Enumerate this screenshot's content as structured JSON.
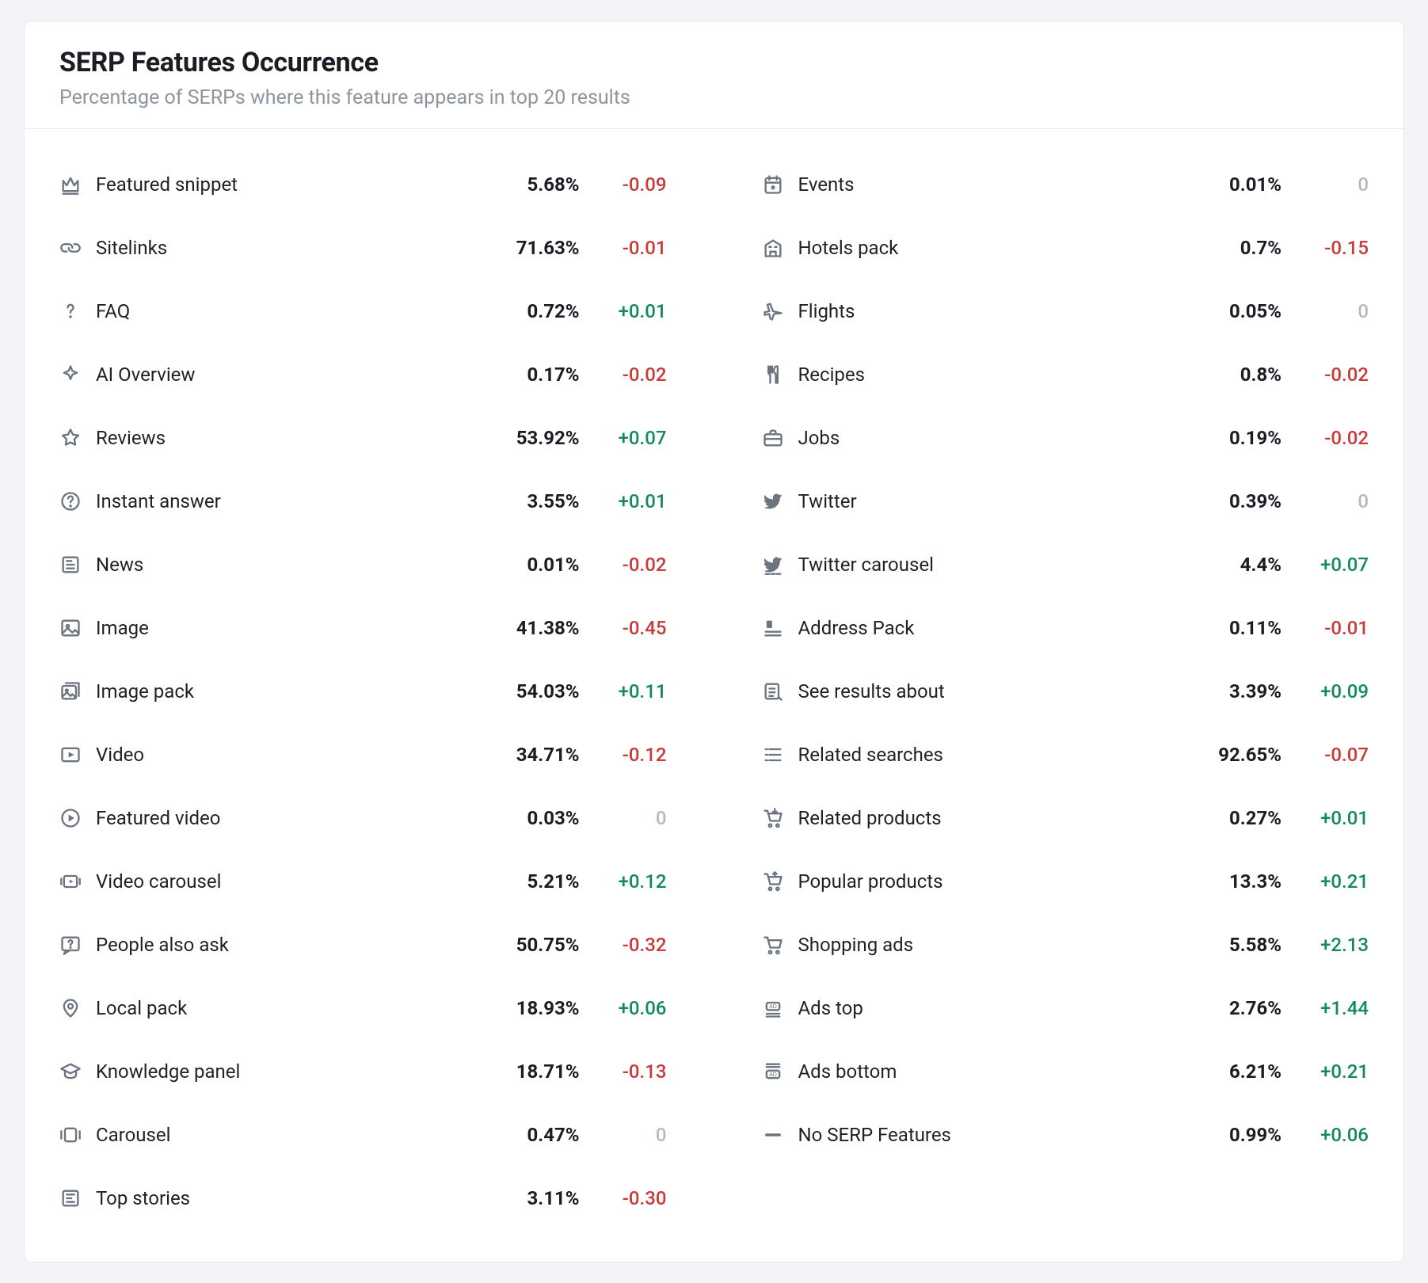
{
  "header": {
    "title": "SERP Features Occurrence",
    "subtitle": "Percentage of SERPs where this feature appears in top 20 results"
  },
  "columns": [
    [
      {
        "icon": "crown",
        "label": "Featured snippet",
        "pct": "5.68%",
        "delta": "-0.09",
        "dir": "neg"
      },
      {
        "icon": "link",
        "label": "Sitelinks",
        "pct": "71.63%",
        "delta": "-0.01",
        "dir": "neg"
      },
      {
        "icon": "question-mark",
        "label": "FAQ",
        "pct": "0.72%",
        "delta": "+0.01",
        "dir": "pos"
      },
      {
        "icon": "sparkle",
        "label": "AI Overview",
        "pct": "0.17%",
        "delta": "-0.02",
        "dir": "neg"
      },
      {
        "icon": "star",
        "label": "Reviews",
        "pct": "53.92%",
        "delta": "+0.07",
        "dir": "pos"
      },
      {
        "icon": "question-circle",
        "label": "Instant answer",
        "pct": "3.55%",
        "delta": "+0.01",
        "dir": "pos"
      },
      {
        "icon": "news",
        "label": "News",
        "pct": "0.01%",
        "delta": "-0.02",
        "dir": "neg"
      },
      {
        "icon": "image",
        "label": "Image",
        "pct": "41.38%",
        "delta": "-0.45",
        "dir": "neg"
      },
      {
        "icon": "image-pack",
        "label": "Image pack",
        "pct": "54.03%",
        "delta": "+0.11",
        "dir": "pos"
      },
      {
        "icon": "video",
        "label": "Video",
        "pct": "34.71%",
        "delta": "-0.12",
        "dir": "neg"
      },
      {
        "icon": "play-circle",
        "label": "Featured video",
        "pct": "0.03%",
        "delta": "0",
        "dir": "zero"
      },
      {
        "icon": "video-carousel",
        "label": "Video carousel",
        "pct": "5.21%",
        "delta": "+0.12",
        "dir": "pos"
      },
      {
        "icon": "people-also-ask",
        "label": "People also ask",
        "pct": "50.75%",
        "delta": "-0.32",
        "dir": "neg"
      },
      {
        "icon": "pin",
        "label": "Local pack",
        "pct": "18.93%",
        "delta": "+0.06",
        "dir": "pos"
      },
      {
        "icon": "graduation",
        "label": "Knowledge panel",
        "pct": "18.71%",
        "delta": "-0.13",
        "dir": "neg"
      },
      {
        "icon": "carousel",
        "label": "Carousel",
        "pct": "0.47%",
        "delta": "0",
        "dir": "zero"
      },
      {
        "icon": "top-stories",
        "label": "Top stories",
        "pct": "3.11%",
        "delta": "-0.30",
        "dir": "neg"
      }
    ],
    [
      {
        "icon": "calendar-star",
        "label": "Events",
        "pct": "0.01%",
        "delta": "0",
        "dir": "zero"
      },
      {
        "icon": "hotel",
        "label": "Hotels pack",
        "pct": "0.7%",
        "delta": "-0.15",
        "dir": "neg"
      },
      {
        "icon": "plane",
        "label": "Flights",
        "pct": "0.05%",
        "delta": "0",
        "dir": "zero"
      },
      {
        "icon": "utensils",
        "label": "Recipes",
        "pct": "0.8%",
        "delta": "-0.02",
        "dir": "neg"
      },
      {
        "icon": "briefcase",
        "label": "Jobs",
        "pct": "0.19%",
        "delta": "-0.02",
        "dir": "neg"
      },
      {
        "icon": "twitter",
        "label": "Twitter",
        "pct": "0.39%",
        "delta": "0",
        "dir": "zero"
      },
      {
        "icon": "twitter-carousel",
        "label": "Twitter carousel",
        "pct": "4.4%",
        "delta": "+0.07",
        "dir": "pos"
      },
      {
        "icon": "address",
        "label": "Address Pack",
        "pct": "0.11%",
        "delta": "-0.01",
        "dir": "neg"
      },
      {
        "icon": "results-about",
        "label": "See results about",
        "pct": "3.39%",
        "delta": "+0.09",
        "dir": "pos"
      },
      {
        "icon": "list",
        "label": "Related searches",
        "pct": "92.65%",
        "delta": "-0.07",
        "dir": "neg"
      },
      {
        "icon": "cart-related",
        "label": "Related products",
        "pct": "0.27%",
        "delta": "+0.01",
        "dir": "pos"
      },
      {
        "icon": "cart-popular",
        "label": "Popular products",
        "pct": "13.3%",
        "delta": "+0.21",
        "dir": "pos"
      },
      {
        "icon": "cart",
        "label": "Shopping ads",
        "pct": "5.58%",
        "delta": "+2.13",
        "dir": "pos"
      },
      {
        "icon": "ad-top",
        "label": "Ads top",
        "pct": "2.76%",
        "delta": "+1.44",
        "dir": "pos"
      },
      {
        "icon": "ad-bottom",
        "label": "Ads bottom",
        "pct": "6.21%",
        "delta": "+0.21",
        "dir": "pos"
      },
      {
        "icon": "minus",
        "label": "No SERP Features",
        "pct": "0.99%",
        "delta": "+0.06",
        "dir": "pos"
      }
    ]
  ]
}
